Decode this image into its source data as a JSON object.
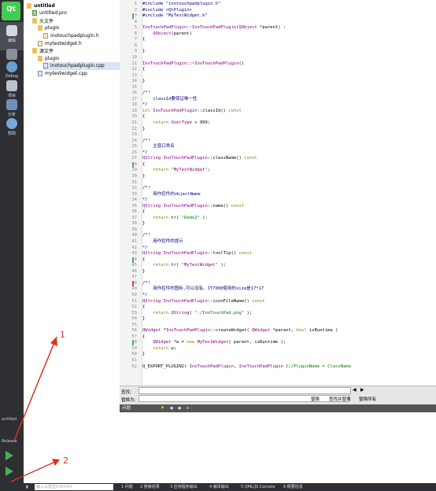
{
  "modebar": {
    "items": [
      {
        "label": "欢迎",
        "icon": "qt-logo-icon"
      },
      {
        "label": "编辑",
        "icon": "edit-icon"
      },
      {
        "label": "设计",
        "icon": "design-icon"
      },
      {
        "label": "Debug",
        "icon": "debug-icon"
      },
      {
        "label": "项目",
        "icon": "projects-icon"
      },
      {
        "label": "分析",
        "icon": "analyze-icon"
      },
      {
        "label": "帮助",
        "icon": "help-icon"
      }
    ],
    "project_name": "untitled",
    "build_config": "Release"
  },
  "tree": {
    "items": [
      {
        "text": "untitled",
        "indent": 0,
        "kind": "project"
      },
      {
        "text": "untitled.pro",
        "indent": 1,
        "kind": "pro"
      },
      {
        "text": "头文件",
        "indent": 1,
        "kind": "folder"
      },
      {
        "text": "plugin",
        "indent": 2,
        "kind": "folder"
      },
      {
        "text": "inotouchpadplugin.h",
        "indent": 3,
        "kind": "fileh"
      },
      {
        "text": "mytestwidget.h",
        "indent": 2,
        "kind": "fileh"
      },
      {
        "text": "源文件",
        "indent": 1,
        "kind": "folder"
      },
      {
        "text": "plugin",
        "indent": 2,
        "kind": "folder"
      },
      {
        "text": "inotouchpadplugin.cpp",
        "indent": 3,
        "kind": "filec",
        "selected": true
      },
      {
        "text": "mytestwidget.cpp",
        "indent": 2,
        "kind": "filec"
      }
    ]
  },
  "editor": {
    "lines": [
      "#include \"inotouchpadplugin.h\"",
      "#include <QtPlugin>",
      "#include \"MyTestWidget.h\"",
      "",
      "InoTouchPadPlugin::InoTouchPadPlugin(QObject *parent) :",
      "    QObject(parent)",
      "{",
      "",
      "}",
      "",
      "InoTouchPadPlugin::~InoTouchPadPlugin()",
      "{",
      "",
      "}",
      "",
      "/*!",
      "    classId要保证唯一性",
      "*/",
      "int InoTouchPadPlugin::classId() const",
      "{",
      "    return UserType + 999;",
      "}",
      "",
      "/*!",
      "    主窗口类名",
      "*/",
      "QString InoTouchPadPlugin::className() const",
      "{",
      "    return \"MyTestWidget\";",
      "}",
      "",
      "/*!",
      "    用作控件的objectName",
      "*/",
      "QString InoTouchPadPlugin::name() const",
      "{",
      "    return tr( \"Demo2\" );",
      "}",
      "",
      "/*!",
      "    用作控件的提示",
      "*/",
      "QString InoTouchPadPlugin::toolTip() const",
      "{",
      "    return tr( \"MyTestWidget\" );",
      "}",
      "",
      "/*!",
      "    用作控件的图标,可以没有。IT7000使用的size是17*17",
      "*/",
      "QString InoTouchPadPlugin::iconFileName() const",
      "{",
      "    return QString( \":/InoTouchPad.png\" );",
      "}",
      "",
      "QWidget *InoTouchPadPlugin::createWidget( QWidget *parent, bool isRuntime )",
      "{",
      "    QWidget *w = new MyTestWidget( parent, isRuntime );",
      "    return w;",
      "}",
      "",
      "Q_EXPORT_PLUGIN2( InoTouchPadPlugin, InoTouchPadPlugin )//PluginName = ClassName"
    ]
  },
  "findbar": {
    "find_label": "查找:",
    "replace_label": "替换为:",
    "find_placeholder": "",
    "replace_btn": "替换",
    "find_replace_btn": "查找并替换",
    "replace_all_btn": "替换所有"
  },
  "issues": {
    "title": "问题"
  },
  "statusbar": {
    "locator_placeholder": "输入以定位(Ctrl+K)",
    "tabs": [
      "1 问题",
      "2 搜索结果",
      "3 应用程序输出",
      "4 编译输出",
      "5 QML/JS Console",
      "6 概要信息"
    ]
  },
  "annotations": {
    "one": "1",
    "two": "2"
  },
  "colors": {
    "keyword": "#808000",
    "type": "#800080",
    "string": "#008000",
    "comment": "#000080",
    "accent": "#e03020"
  }
}
